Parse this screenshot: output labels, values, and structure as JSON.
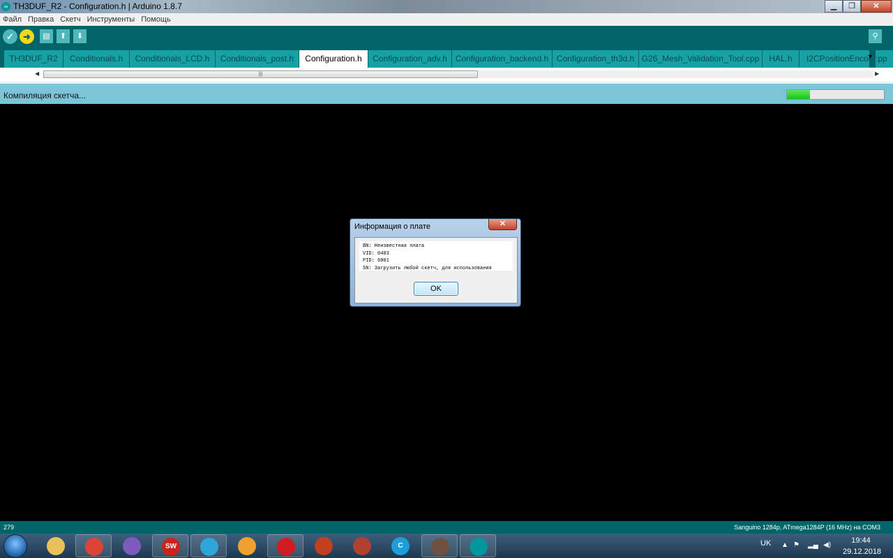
{
  "window": {
    "title": "TH3DUF_R2 - Configuration.h | Arduino 1.8.7",
    "app_icon": "arduino-infinity-icon"
  },
  "menu": [
    "Файл",
    "Правка",
    "Скетч",
    "Инструменты",
    "Помощь"
  ],
  "toolbar": {
    "verify_icon": "check-icon",
    "upload_icon": "arrow-right-icon",
    "new_icon": "new-file-icon",
    "open_icon": "arrow-up-icon",
    "save_icon": "arrow-down-icon",
    "serial_icon": "magnifier-icon"
  },
  "tabs": [
    "TH3DUF_R2",
    "Conditionals.h",
    "Conditionals_LCD.h",
    "Conditionals_post.h",
    "Configuration.h",
    "Configuration_adv.h",
    "Configuration_backend.h",
    "Configuration_th3d.h",
    "G26_Mesh_Validation_Tool.cpp",
    "HAL.h",
    "I2CPositionEncod"
  ],
  "active_tab": "Configuration.h",
  "tab_overflow_text": ":pp",
  "status": {
    "message": "Компиляция скетча...",
    "progress": 0.24
  },
  "footer": {
    "line_number": "279",
    "board": "Sanguino 1284p, ATmega1284P (16 MHz) на COM3"
  },
  "dialog": {
    "title": "Информация о плате",
    "lines": [
      "BN: Неизвестная плата",
      "VID: 0403",
      "PID: 6001",
      "SN: Загрузить любой скетч, для использования"
    ],
    "ok_label": "OK"
  },
  "taskbar": {
    "apps": [
      {
        "name": "file-explorer-icon",
        "color": "#e8c15a"
      },
      {
        "name": "chrome-icon",
        "color": "#db4437"
      },
      {
        "name": "viber-icon",
        "color": "#7d5bbd"
      },
      {
        "name": "solidworks-icon",
        "color": "#c8261c",
        "label": "SW"
      },
      {
        "name": "telegram-icon",
        "color": "#2ea6dc"
      },
      {
        "name": "camera-app-icon",
        "color": "#f0a030"
      },
      {
        "name": "opera-icon",
        "color": "#d01b22"
      },
      {
        "name": "slicer-icon",
        "color": "#c04020"
      },
      {
        "name": "cube-app-icon",
        "color": "#b04030"
      },
      {
        "name": "cura-c-icon",
        "color": "#1d9ddb",
        "label": "C"
      },
      {
        "name": "game-app-icon",
        "color": "#705040"
      },
      {
        "name": "arduino-icon",
        "color": "#00979c"
      }
    ],
    "language": "UK",
    "tray_icons": [
      "arrow-up-icon",
      "network-flag-icon",
      "signal-icon",
      "volume-icon"
    ],
    "time": "19:44",
    "date": "29.12.2018"
  }
}
